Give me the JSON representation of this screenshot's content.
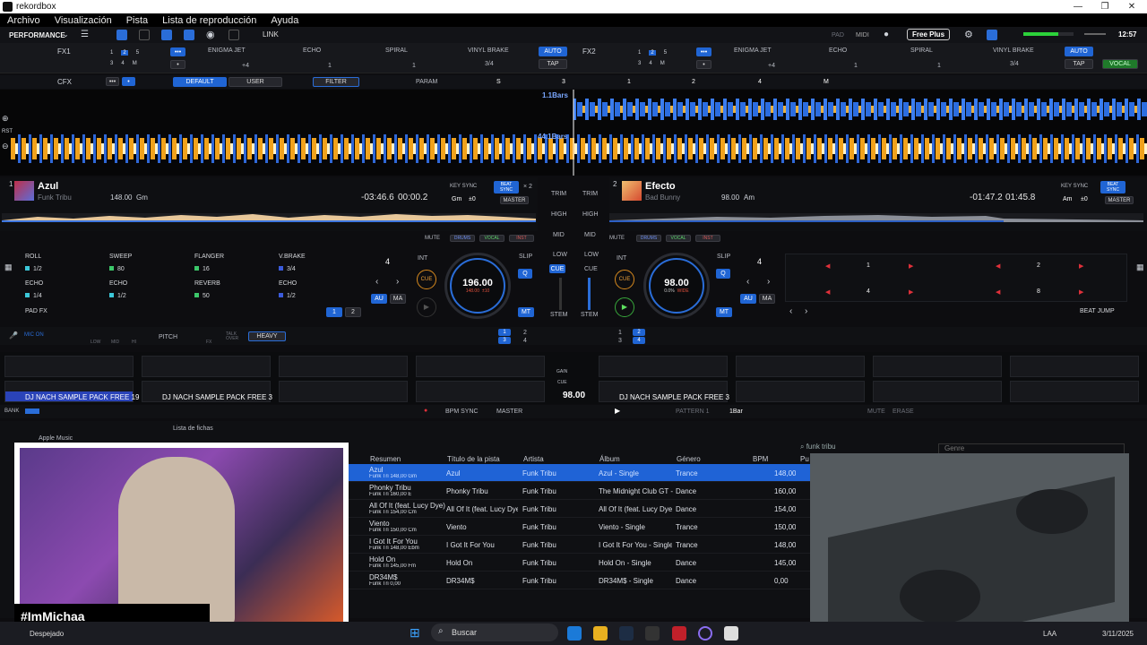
{
  "window": {
    "title": "rekordbox",
    "controls": [
      "—",
      "❐",
      "✕"
    ]
  },
  "menu": [
    "Archivo",
    "Visualización",
    "Pista",
    "Lista de reproducción",
    "Ayuda"
  ],
  "toolbar": {
    "mode": "PERFORMANCE",
    "link": "LINK",
    "pad": "PAD",
    "midi": "MIDI",
    "plan": "Free Plus",
    "clock": "12:57"
  },
  "fx1": {
    "label": "FX1",
    "slots": [
      "ENIGMA JET",
      "ECHO",
      "SPIRAL",
      "VINYL BRAKE"
    ],
    "beat_nums": [
      "1",
      "2",
      "5",
      "3",
      "4",
      "M"
    ],
    "plus4": "+4",
    "val1": "1",
    "val2": "1",
    "frac": "3/4",
    "auto": "AUTO",
    "tap": "TAP"
  },
  "fx2": {
    "label": "FX2",
    "slots": [
      "ENIGMA JET",
      "ECHO",
      "SPIRAL",
      "VINYL BRAKE"
    ],
    "beat_nums": [
      "1",
      "2",
      "5",
      "3",
      "4",
      "M"
    ],
    "plus4": "+4",
    "val1": "1",
    "val2": "1",
    "frac": "3/4",
    "auto": "AUTO",
    "tap": "TAP",
    "vocal": "VOCAL",
    "drums": "DRUMS"
  },
  "cfx": {
    "label": "CFX",
    "default": "DEFAULT",
    "user": "USER",
    "filter": "FILTER",
    "param": "PARAM",
    "s": "S",
    "nums": [
      "3",
      "1",
      "2",
      "4"
    ],
    "m": "M"
  },
  "wave": {
    "top_label": "1.1Bars",
    "bottom_label": "44.1Bars",
    "rst": "RST"
  },
  "deck1": {
    "num": "1",
    "title": "Azul",
    "artist": "Funk Tribu",
    "bpm": "148.00",
    "key": "Gm",
    "time_remain": "-03:46.6",
    "time_elapsed": "00:00.2",
    "key_sync": "KEY SYNC",
    "key_val": "Gm",
    "key_off": "±0",
    "beat_sync": "BEAT SYNC",
    "x2": "× 2",
    "master": "MASTER",
    "mute": "MUTE",
    "drums": "DRUMS",
    "vocal": "VOCAL",
    "inst": "INST"
  },
  "deck2": {
    "num": "2",
    "title": "Efecto",
    "artist": "Bad Bunny",
    "bpm": "98.00",
    "key": "Am",
    "time_remain": "-01:47.2",
    "time_elapsed": "01:45.8",
    "key_sync": "KEY SYNC",
    "key_val": "Am",
    "key_off": "±0",
    "beat_sync": "BEAT SYNC",
    "master": "MASTER",
    "mute": "MUTE",
    "drums": "DRUMS",
    "vocal": "VOCAL",
    "inst": "INST"
  },
  "mixer": {
    "trim": "TRIM",
    "high": "HIGH",
    "mid": "MID",
    "low": "LOW",
    "cue": "CUE",
    "stem": "STEM"
  },
  "pads_left": {
    "items": [
      {
        "name": "ROLL",
        "val": "1/2",
        "color": "#3cc7d8"
      },
      {
        "name": "SWEEP",
        "val": "80",
        "color": "#3cc76a"
      },
      {
        "name": "FLANGER",
        "val": "16",
        "color": "#3cc76a"
      },
      {
        "name": "V.BRAKE",
        "val": "3/4",
        "color": "#3b5bdb"
      },
      {
        "name": "ECHO",
        "val": "1/4",
        "color": "#3cc7d8"
      },
      {
        "name": "ECHO",
        "val": "1/2",
        "color": "#3cc7d8"
      },
      {
        "name": "REVERB",
        "val": "50",
        "color": "#3cc76a"
      },
      {
        "name": "ECHO",
        "val": "1/2",
        "color": "#3b5bdb"
      }
    ],
    "mode": "PAD FX",
    "p1": "1",
    "p2": "2"
  },
  "jog1": {
    "bpm": "196.00",
    "pitch": "148.00",
    "pitch2": "±10",
    "loop": "4",
    "int": "INT",
    "slip": "SLIP",
    "q": "Q",
    "au": "AU",
    "ma": "MA",
    "mt": "MT",
    "cue": "CUE"
  },
  "jog2": {
    "bpm": "98.00",
    "pitch": "0.0%",
    "pitch2": "WIDE",
    "loop": "4",
    "int": "INT",
    "slip": "SLIP",
    "q": "Q",
    "au": "AU",
    "ma": "MA",
    "mt": "MT",
    "cue": "CUE"
  },
  "pads_right": {
    "items": [
      "1",
      "2",
      "4",
      "8"
    ],
    "mode": "BEAT JUMP",
    "loop": "4"
  },
  "mic": {
    "mic_on": "MIC ON",
    "low": "LOW",
    "mid": "MID",
    "hi": "HI",
    "pitch": "PITCH",
    "fx": "FX",
    "talkover": "TALK OVER",
    "heavy": "HEAVY",
    "nums": [
      "1",
      "2",
      "3",
      "4"
    ]
  },
  "sampler": {
    "slot1": "DJ NACH SAMPLE PACK FREE 19",
    "slot2": "DJ NACH SAMPLE PACK FREE 3",
    "slot3": "DJ NACH SAMPLE PACK FREE 3",
    "gain": "GAIN",
    "cue": "CUE",
    "bpm": "98.00",
    "bank": "BANK",
    "bpm_sync": "BPM SYNC",
    "master": "MASTER",
    "pattern": "PATTERN 1",
    "bar": "1Bar",
    "mute": "MUTE",
    "erase": "ERASE"
  },
  "browser": {
    "tree_item": "Apple Music",
    "tab": "Lista de fichas",
    "search": "funk tribu",
    "genre_placeholder": "Genre",
    "columns": [
      "Resumen",
      "Título de la pista",
      "Artista",
      "Álbum",
      "Género",
      "BPM",
      "Pu"
    ],
    "rows": [
      {
        "title": "Azul",
        "sub": "Funk Tri  148,00  Gm",
        "track": "Azul",
        "artist": "Funk Tribu",
        "album": "Azul - Single",
        "genre": "Trance",
        "bpm": "148,00"
      },
      {
        "title": "Phonky Tribu",
        "sub": "Funk Tri  160,00  E",
        "track": "Phonky Tribu",
        "artist": "Funk Tribu",
        "album": "The Midnight Club GT -",
        "genre": "Dance",
        "bpm": "160,00"
      },
      {
        "title": "All Of It (feat. Lucy Dye)",
        "sub": "Funk Tri  154,00  Cm",
        "track": "All Of It (feat. Lucy Dye)",
        "artist": "Funk Tribu",
        "album": "All Of It (feat. Lucy Dye)",
        "genre": "Dance",
        "bpm": "154,00"
      },
      {
        "title": "Viento",
        "sub": "Funk Tri  150,00  Cm",
        "track": "Viento",
        "artist": "Funk Tribu",
        "album": "Viento - Single",
        "genre": "Trance",
        "bpm": "150,00"
      },
      {
        "title": "I Got It For You",
        "sub": "Funk Tri  148,00  Ebm",
        "track": "I Got It For You",
        "artist": "Funk Tribu",
        "album": "I Got It For You - Single",
        "genre": "Trance",
        "bpm": "148,00"
      },
      {
        "title": "Hold On",
        "sub": "Funk Tri  145,00  Fm",
        "track": "Hold On",
        "artist": "Funk Tribu",
        "album": "Hold On - Single",
        "genre": "Dance",
        "bpm": "145,00"
      },
      {
        "title": "DR34M$",
        "sub": "Funk Tri  0,00",
        "track": "DR34M$",
        "artist": "Funk Tribu",
        "album": "DR34M$ - Single",
        "genre": "Dance",
        "bpm": "0,00"
      }
    ]
  },
  "overlay": {
    "handle": "#ImMichaa"
  },
  "taskbar": {
    "weather": "Despejado",
    "search": "Buscar",
    "lang": "LAA",
    "date": "3/11/2025"
  }
}
